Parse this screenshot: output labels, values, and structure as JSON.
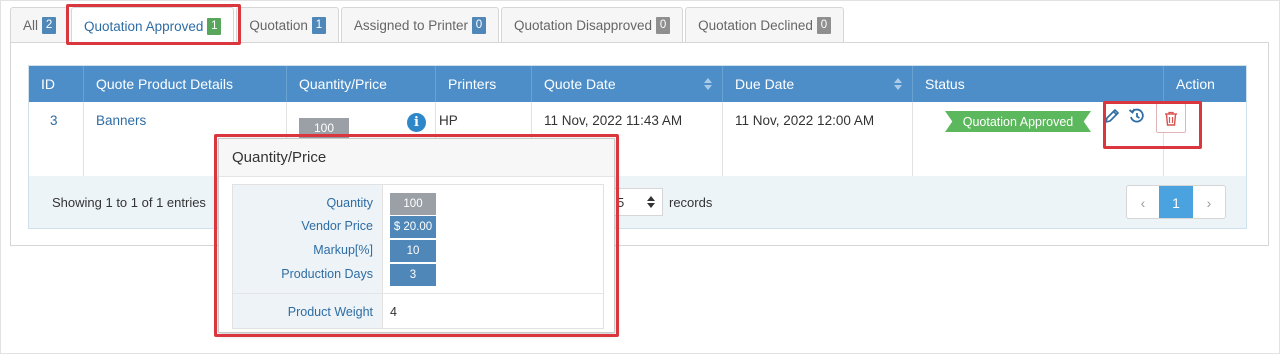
{
  "tabs": [
    {
      "label": "All",
      "count": "2",
      "badge": "blue",
      "active": false
    },
    {
      "label": "Quotation Approved",
      "count": "1",
      "badge": "green",
      "active": true
    },
    {
      "label": "Quotation",
      "count": "1",
      "badge": "blue",
      "active": false
    },
    {
      "label": "Assigned to Printer",
      "count": "0",
      "badge": "blue",
      "active": false
    },
    {
      "label": "Quotation Disapproved",
      "count": "0",
      "badge": "grey",
      "active": false
    },
    {
      "label": "Quotation Declined",
      "count": "0",
      "badge": "grey",
      "active": false
    }
  ],
  "table": {
    "headers": {
      "id": "ID",
      "details": "Quote Product Details",
      "qty_price": "Quantity/Price",
      "printers": "Printers",
      "quote_date": "Quote Date",
      "due_date": "Due Date",
      "status": "Status",
      "action": "Action"
    },
    "row": {
      "id": "3",
      "product": "Banners",
      "quantity": "100",
      "printer": "HP",
      "quote_date": "11 Nov, 2022 11:43 AM",
      "due_date": "11 Nov, 2022 12:00 AM",
      "status": "Quotation Approved"
    }
  },
  "footer": {
    "showing": "Showing 1 to 1 of 1 entries",
    "records_value": "5",
    "records_label": "records",
    "pages": [
      "‹",
      "1",
      "›"
    ]
  },
  "popover": {
    "title": "Quantity/Price",
    "rows": [
      {
        "label": "Quantity",
        "value": "100"
      },
      {
        "label": "Vendor Price",
        "value": "$ 20.00"
      },
      {
        "label": "Markup[%]",
        "value": "10"
      },
      {
        "label": "Production Days",
        "value": "3"
      }
    ],
    "weight_label": "Product Weight",
    "weight_value": "4"
  },
  "colors": {
    "header_bg": "#4d8ec8",
    "status_green": "#5cb85c",
    "highlight_red": "#d9363e",
    "link_blue": "#2e6da4"
  },
  "icons": {
    "info": "info-icon",
    "edit": "pencil-icon",
    "history": "history-icon",
    "delete": "trash-icon"
  }
}
